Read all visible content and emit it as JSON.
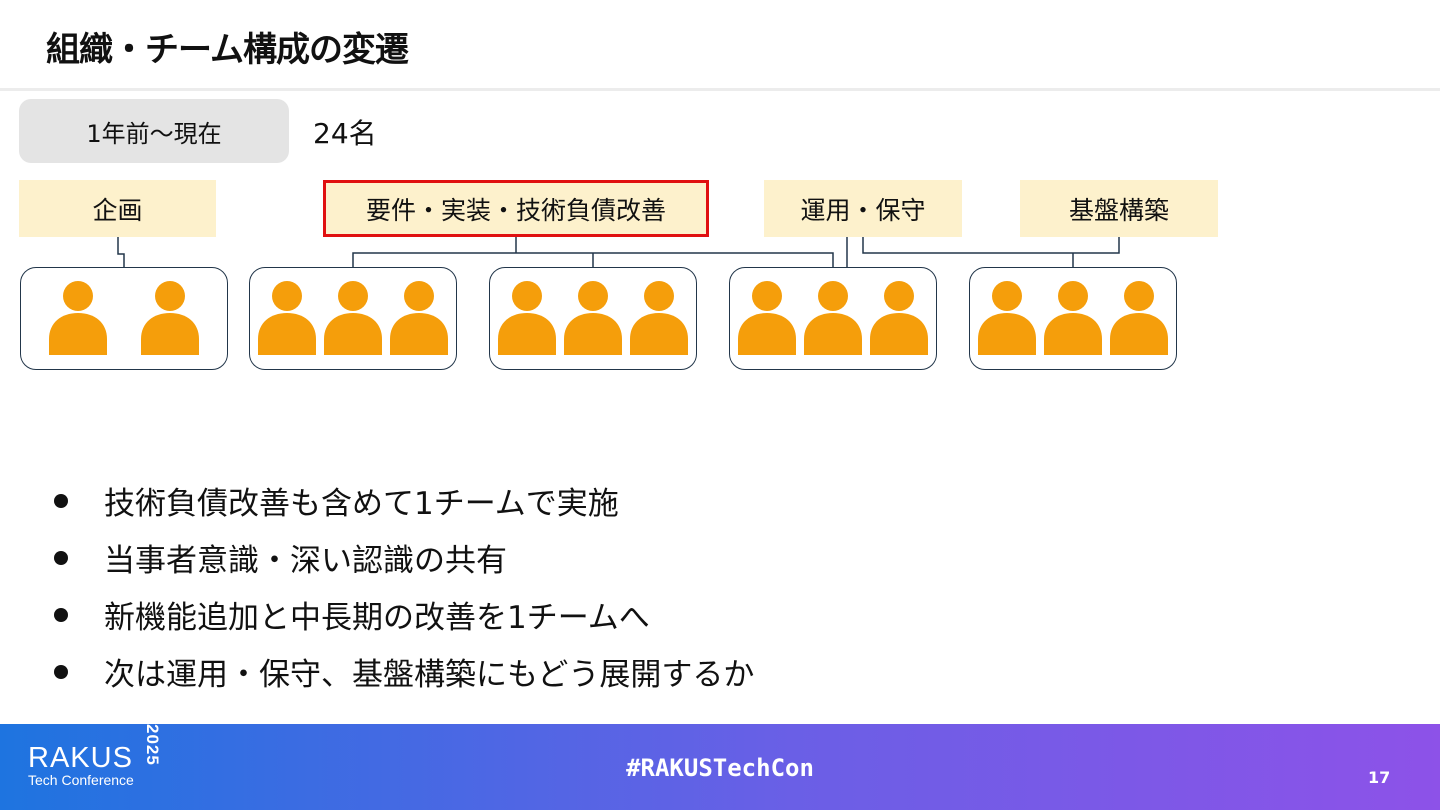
{
  "header": {
    "title": "組織・チーム構成の変遷"
  },
  "period": {
    "label": "1年前〜現在",
    "count": "24名"
  },
  "roles": [
    {
      "label": "企画"
    },
    {
      "label": "要件・実装・技術負債改善",
      "highlighted": true
    },
    {
      "label": "運用・保守"
    },
    {
      "label": "基盤構築"
    }
  ],
  "teams": [
    {
      "members": 2
    },
    {
      "members": 3
    },
    {
      "members": 3
    },
    {
      "members": 3
    },
    {
      "members": 3
    }
  ],
  "bullets": [
    "技術負債改善も含めて1チームで実施",
    "当事者意識・深い認識の共有",
    "新機能追加と中長期の改善を1チームへ",
    "次は運用・保守、基盤構築にもどう展開するか"
  ],
  "footer": {
    "logo_main": "RAKUS",
    "logo_sub": "Tech Conference",
    "logo_year": "2025",
    "hashtag": "#RAKUSTechCon",
    "page_number": "17"
  },
  "colors": {
    "person": "#f59e0b",
    "role_bg": "#fdf1cc",
    "highlight_border": "#e01010",
    "connector": "#22364a"
  },
  "icons": {
    "member": "person-icon"
  }
}
